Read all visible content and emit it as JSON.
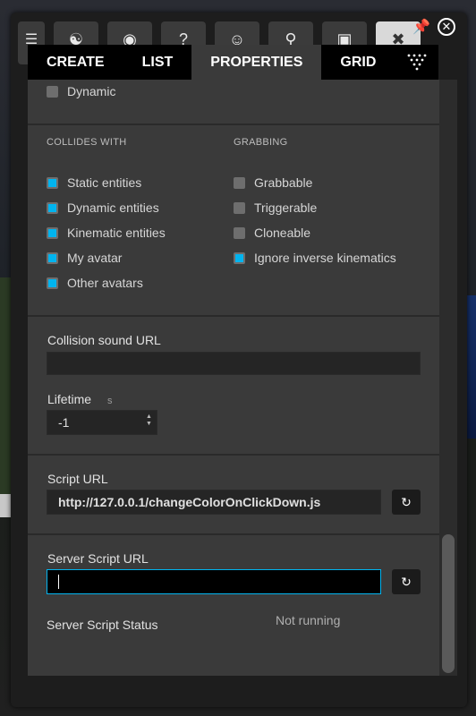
{
  "toolbar": {
    "menu_label": "M",
    "buttons": [
      "avatar-icon",
      "camera-icon",
      "help-icon",
      "people-icon",
      "search-icon",
      "market-icon",
      "edit-icon"
    ]
  },
  "tabs": [
    {
      "label": "CREATE"
    },
    {
      "label": "LIST"
    },
    {
      "label": "PROPERTIES",
      "active": true
    },
    {
      "label": "GRID"
    }
  ],
  "physics": {
    "dynamic_label": "Dynamic",
    "dynamic_checked": false
  },
  "collides_with": {
    "heading": "COLLIDES WITH",
    "items": [
      {
        "label": "Static entities",
        "checked": true
      },
      {
        "label": "Dynamic entities",
        "checked": true
      },
      {
        "label": "Kinematic entities",
        "checked": true
      },
      {
        "label": "My avatar",
        "checked": true
      },
      {
        "label": "Other avatars",
        "checked": true
      }
    ]
  },
  "grabbing": {
    "heading": "GRABBING",
    "items": [
      {
        "label": "Grabbable",
        "checked": false
      },
      {
        "label": "Triggerable",
        "checked": false
      },
      {
        "label": "Cloneable",
        "checked": false
      },
      {
        "label": "Ignore inverse kinematics",
        "checked": true
      }
    ]
  },
  "collision_sound": {
    "label": "Collision sound URL",
    "value": ""
  },
  "lifetime": {
    "label": "Lifetime",
    "unit": "s",
    "value": "-1"
  },
  "script": {
    "label": "Script URL",
    "value": "http://127.0.0.1/changeColorOnClickDown.js"
  },
  "server_script": {
    "label": "Server Script URL",
    "value": "",
    "status_label": "Server Script Status",
    "status_value": "Not running"
  },
  "colors": {
    "accent": "#00b4ef",
    "panel": "#3a3a3a",
    "tab_bar": "#000000"
  }
}
